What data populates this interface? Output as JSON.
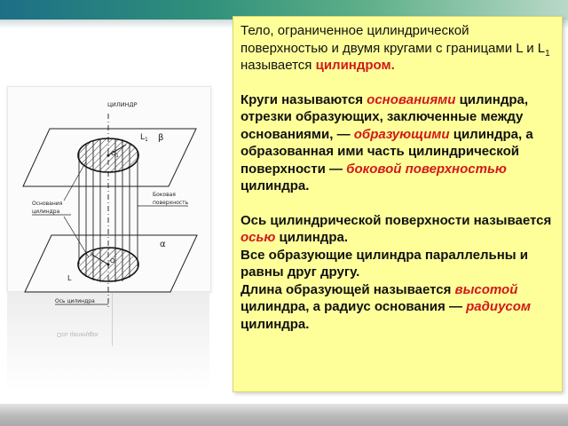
{
  "diagram": {
    "title": "ЦИЛИНДР",
    "label_L1": "L",
    "label_L1_sub": "1",
    "label_beta": "β",
    "label_O1": "O",
    "label_O1_sub": "1",
    "label_bases": [
      "Основания",
      "цилиндра"
    ],
    "label_side": [
      "Боковая",
      "поверхность"
    ],
    "label_alpha": "α",
    "label_O": "O",
    "label_L": "L",
    "label_R": "R",
    "label_axis": "Ось цилиндра",
    "reflect_caption": "Ось цилиндра"
  },
  "text": {
    "p1_a": "Тело, ограниченное цилиндрической поверхностью и двумя кругами с границами L и L",
    "p1_sub": "1",
    "p1_b": " называется ",
    "p1_term": "цилиндром.",
    "p2_a": "Круги называются ",
    "p2_term1": "основаниями",
    "p2_b": " цилиндра, отрезки образующих, заключенные между основаниями, — ",
    "p2_term2": "образующими",
    "p2_c": " цилиндра, а образованная ими часть цилиндрической поверхности — ",
    "p2_term3": "боковой поверхностью",
    "p2_d": " цилиндра.",
    "p3_a": "Ось цилиндрической поверхности называется ",
    "p3_term1": "осью",
    "p3_b": " цилиндра.",
    "p3_c": "Все образующие цилиндра параллельны и равны друг другу.",
    "p3_d": "Длина образующей называется ",
    "p3_term2": "высотой",
    "p3_e": " цилиндра, а радиус основания — ",
    "p3_term3": "радиусом",
    "p3_f": " цилиндра."
  }
}
